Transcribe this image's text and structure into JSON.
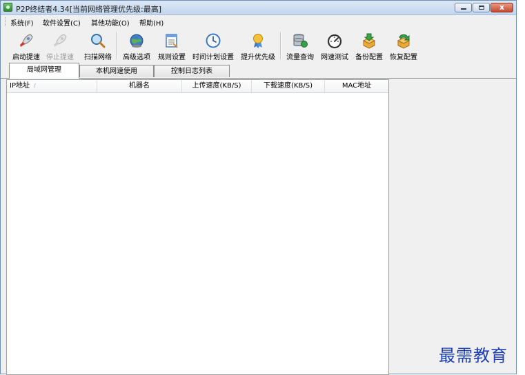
{
  "window": {
    "title": "P2P终结者4.34[当前网络管理优先级:最高]",
    "close_glyph": "x"
  },
  "menu": [
    "系统(F)",
    "软件设置(C)",
    "其他功能(O)",
    "帮助(H)"
  ],
  "toolbar": [
    {
      "label": "启动提速",
      "icon": "rocket-icon",
      "enabled": true
    },
    {
      "label": "停止提速",
      "icon": "stop-rocket-icon",
      "enabled": false
    },
    {
      "label": "扫描网络",
      "icon": "magnifier-icon",
      "enabled": true
    },
    {
      "label": "高级选项",
      "icon": "globe-gear-icon",
      "enabled": true
    },
    {
      "label": "规则设置",
      "icon": "rules-document-icon",
      "enabled": true
    },
    {
      "label": "时间计划设置",
      "icon": "clock-icon",
      "enabled": true
    },
    {
      "label": "提升优先级",
      "icon": "priority-medal-icon",
      "enabled": true
    },
    {
      "label": "流量查询",
      "icon": "database-icon",
      "enabled": true
    },
    {
      "label": "网速测试",
      "icon": "speedometer-icon",
      "enabled": true
    },
    {
      "label": "备份配置",
      "icon": "backup-box-icon",
      "enabled": true
    },
    {
      "label": "恢复配置",
      "icon": "restore-box-icon",
      "enabled": true
    }
  ],
  "tabs": [
    "局域网管理",
    "本机网速使用",
    "控制日志列表"
  ],
  "table": {
    "columns": [
      "IP地址",
      "机器名",
      "上传速度(KB/S)",
      "下载速度(KB/S)",
      "MAC地址"
    ],
    "rows": []
  },
  "watermark": "最需教育"
}
